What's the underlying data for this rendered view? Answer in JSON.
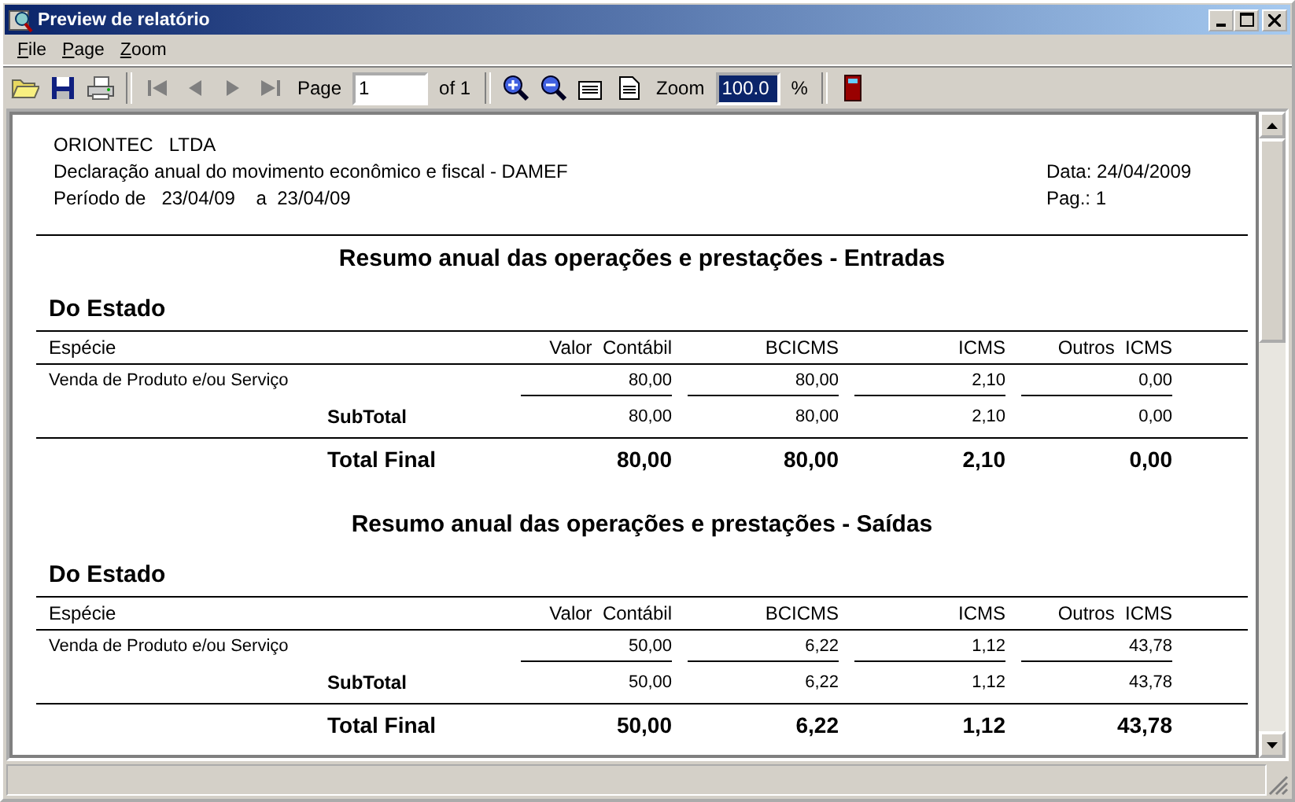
{
  "window": {
    "title": "Preview de relatório"
  },
  "menu": [
    {
      "label": "File"
    },
    {
      "label": "Page"
    },
    {
      "label": "Zoom"
    }
  ],
  "toolbar": {
    "navigation": [
      {
        "disabled": true
      },
      {
        "disabled": true
      },
      {
        "disabled": true
      },
      {
        "disabled": true
      }
    ],
    "page_label": "Page",
    "page_field": {
      "value": "1"
    },
    "page_count": "of 1",
    "zoom_label": "Zoom",
    "zoom_field": {
      "value": "100.0",
      "selected": true
    },
    "zoom_unit": "%"
  },
  "report": {
    "company": "ORIONTEC   LTDA",
    "description": "Declaração anual do movimento econômico e fiscal - DAMEF",
    "period": "Período de   23/04/09    a  23/04/09",
    "date": "Data: 24/04/2009",
    "page": "Pag.: 1",
    "sections": [
      {
        "title": "Resumo anual das operações e prestações - Entradas",
        "group": "Do Estado",
        "columns": [
          "Espécie",
          "Valor  Contábil",
          "BCICMS",
          "ICMS",
          "Outros  ICMS"
        ],
        "rows": [
          {
            "kind": "detail",
            "label": "Venda de Produto e/ou Serviço",
            "values": [
              "80,00",
              "80,00",
              "2,10",
              "0,00"
            ]
          },
          {
            "kind": "subtotal",
            "label": "SubTotal",
            "values": [
              "80,00",
              "80,00",
              "2,10",
              "0,00"
            ]
          },
          {
            "kind": "total",
            "label": "Total Final",
            "values": [
              "80,00",
              "80,00",
              "2,10",
              "0,00"
            ]
          }
        ]
      },
      {
        "title": "Resumo anual das operações e prestações - Saídas",
        "group": "Do Estado",
        "columns": [
          "Espécie",
          "Valor  Contábil",
          "BCICMS",
          "ICMS",
          "Outros  ICMS"
        ],
        "rows": [
          {
            "kind": "detail",
            "label": "Venda de Produto e/ou Serviço",
            "values": [
              "50,00",
              "6,22",
              "1,12",
              "43,78"
            ]
          },
          {
            "kind": "subtotal",
            "label": "SubTotal",
            "values": [
              "50,00",
              "6,22",
              "1,12",
              "43,78"
            ]
          },
          {
            "kind": "total",
            "label": "Total Final",
            "values": [
              "50,00",
              "6,22",
              "1,12",
              "43,78"
            ]
          }
        ]
      }
    ]
  }
}
